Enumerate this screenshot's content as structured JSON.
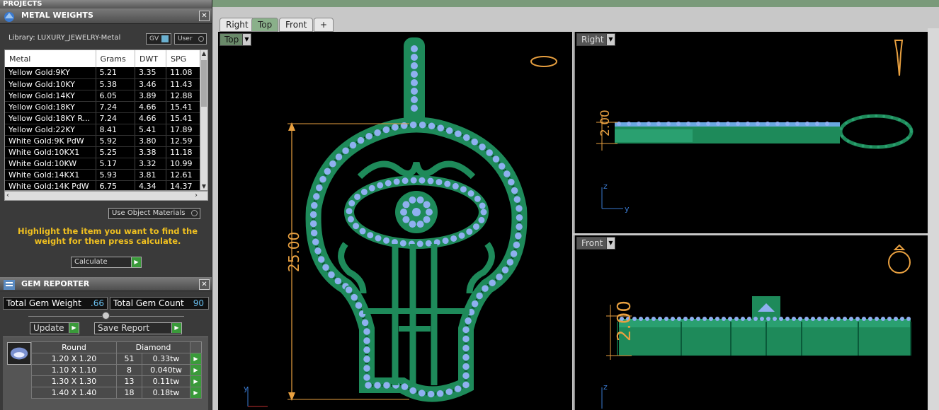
{
  "projects": {
    "title": "PROJECTS"
  },
  "metal": {
    "title": "METAL WEIGHTS",
    "library": "Library: LUXURY_JEWELRY-Metal",
    "gv_label": "GV",
    "user_label": "User",
    "columns": [
      "Metal",
      "Grams",
      "DWT",
      "SPG"
    ],
    "rows": [
      [
        "Yellow Gold:9KY",
        "5.21",
        "3.35",
        "11.08"
      ],
      [
        "Yellow Gold:10KY",
        "5.38",
        "3.46",
        "11.43"
      ],
      [
        "Yellow Gold:14KY",
        "6.05",
        "3.89",
        "12.88"
      ],
      [
        "Yellow Gold:18KY",
        "7.24",
        "4.66",
        "15.41"
      ],
      [
        "Yellow Gold:18KY R...",
        "7.24",
        "4.66",
        "15.41"
      ],
      [
        "Yellow Gold:22KY",
        "8.41",
        "5.41",
        "17.89"
      ],
      [
        "White Gold:9K PdW",
        "5.92",
        "3.80",
        "12.59"
      ],
      [
        "White Gold:10KX1",
        "5.25",
        "3.38",
        "11.18"
      ],
      [
        "White Gold:10KW",
        "5.17",
        "3.32",
        "10.99"
      ],
      [
        "White Gold:14KX1",
        "5.93",
        "3.81",
        "12.61"
      ],
      [
        "White Gold:14K PdW",
        "6.75",
        "4.34",
        "14.37"
      ]
    ],
    "use_object_materials": "Use Object Materials",
    "hint": "Highlight the item you want to find the weight for then press calculate.",
    "calculate": "Calculate"
  },
  "gem": {
    "title": "GEM REPORTER",
    "total_weight_label": "Total Gem Weight",
    "total_weight": ".66",
    "total_count_label": "Total Gem Count",
    "total_count": "90",
    "update": "Update",
    "save_report": "Save Report",
    "shape": "Round",
    "type": "Diamond",
    "rows": [
      [
        "1.20 X 1.20",
        "51",
        "0.33tw"
      ],
      [
        "1.10 X 1.10",
        "8",
        "0.040tw"
      ],
      [
        "1.30 X 1.30",
        "13",
        "0.11tw"
      ],
      [
        "1.40 X 1.40",
        "18",
        "0.18tw"
      ]
    ]
  },
  "viewports": {
    "tabs": [
      "Right",
      "Top",
      "Front",
      "+"
    ],
    "top": {
      "label": "Top",
      "dim": "25.00"
    },
    "right": {
      "label": "Right",
      "dim": "2.00"
    },
    "front": {
      "label": "Front",
      "dim": "2.00"
    },
    "axes": {
      "x": "x",
      "y": "y",
      "z": "z"
    }
  },
  "colors": {
    "jewel": "#1e8a5a",
    "gem": "#8fb0f0",
    "dim": "#e8a040"
  }
}
